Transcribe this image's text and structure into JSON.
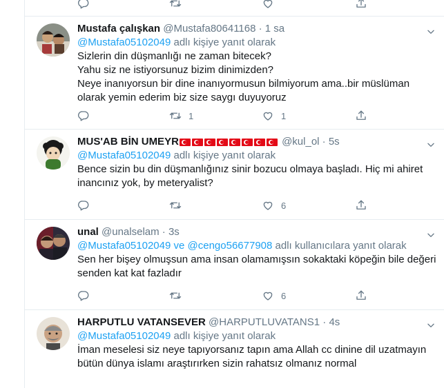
{
  "tweets": [
    {
      "name": "Mustafa çalışkan",
      "handle": "@Mustafa80641168",
      "sep": "·",
      "time": "1 sa",
      "reply_prefix": "",
      "mention1": "@Mustafa05102049",
      "connector": "",
      "mention2": "",
      "reply_suffix": " adlı kişiye yanıt olarak",
      "text": "Sizlerin din düşmanlığı ne zaman bitecek?\nYahu siz ne istiyorsunuz bizim dinimizden?\nNeye inanıyorsun bir dine inanıyormusun  bilmiyorum ama..bir müslüman olarak yemin ederim biz size saygı duyuyoruz",
      "reply_count": "",
      "retweet_count": "1",
      "like_count": "1"
    },
    {
      "name": "MUS'AB BİN UMEYR",
      "handle": "@kul_ol",
      "sep": "·",
      "time": "5s",
      "mention1": "@Mustafa05102049",
      "connector": "",
      "mention2": "",
      "reply_suffix": " adlı kişiye yanıt olarak",
      "text": "Bence sizin bu din düşmanlığınız sinir bozucu olmaya başladı. Hiç mi ahiret inancınız yok, by meteryalist?",
      "reply_count": "",
      "retweet_count": "",
      "like_count": "6"
    },
    {
      "name": "unal",
      "handle": "@unalselam",
      "sep": "·",
      "time": "3s",
      "mention1": "@Mustafa05102049",
      "connector": " ve ",
      "mention2": "@cengo56677908",
      "reply_suffix": " adlı kullanıcılara yanıt olarak",
      "text": "Sen her bişey olmuşsun ama insan olamamışsın sokaktaki köpeğin bile değeri senden kat kat fazladır",
      "reply_count": "",
      "retweet_count": "",
      "like_count": "6"
    },
    {
      "name": "HARPUTLU VATANSEVER",
      "handle": "@HARPUTLUVATANS1",
      "sep": "·",
      "time": "4s",
      "mention1": "@Mustafa05102049",
      "connector": "",
      "mention2": "",
      "reply_suffix": " adlı kişiye yanıt olarak",
      "text": "İman meselesi siz neye tapıyorsanız tapın ama Allah cc dinine dil uzatmayın bütün dünya islamı araştırırken sizin rahatsız olmanız normal",
      "reply_count": "",
      "retweet_count": "",
      "like_count": ""
    }
  ],
  "icons": {
    "reply": "reply-icon",
    "retweet": "retweet-icon",
    "like": "heart-icon",
    "share": "share-icon",
    "more": "chevron-down-icon",
    "flag": "turkish-flag-icon"
  },
  "colors": {
    "link": "#1da1f2",
    "secondary": "#657786",
    "border": "#e6ecf0",
    "text": "#14171a",
    "flag_red": "#e30a17"
  }
}
